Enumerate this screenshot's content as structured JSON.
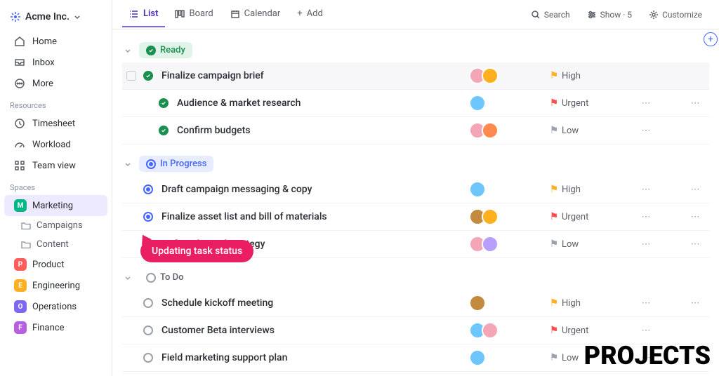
{
  "workspace": {
    "name": "Acme Inc."
  },
  "nav": {
    "home": "Home",
    "inbox": "Inbox",
    "more": "More"
  },
  "resources": {
    "label": "Resources",
    "timesheet": "Timesheet",
    "workload": "Workload",
    "teamview": "Team view"
  },
  "spaces": {
    "label": "Spaces",
    "items": [
      {
        "initial": "M",
        "color": "#00b884",
        "label": "Marketing",
        "active": true
      },
      {
        "initial": "P",
        "color": "#ff5c5c",
        "label": "Product"
      },
      {
        "initial": "E",
        "color": "#ffb020",
        "label": "Engineering"
      },
      {
        "initial": "O",
        "color": "#7b68ee",
        "label": "Operations"
      },
      {
        "initial": "F",
        "color": "#b660e0",
        "label": "Finance"
      }
    ],
    "sub": [
      {
        "label": "Campaigns"
      },
      {
        "label": "Content"
      }
    ]
  },
  "views": {
    "list": "List",
    "board": "Board",
    "calendar": "Calendar",
    "add": "Add"
  },
  "toolbar": {
    "search": "Search",
    "show": "Show · 5",
    "customize": "Customize"
  },
  "groups": [
    {
      "status": "ready",
      "label": "Ready",
      "tasks": [
        {
          "title": "Finalize campaign brief",
          "avatars": [
            "#f4a6b7",
            "#ffb020"
          ],
          "flag": "#ffb020",
          "priority": "High",
          "highlight": true,
          "checkbox": true,
          "showMore1": false
        },
        {
          "title": "Audience & market research",
          "avatars": [
            "#6ec6ff"
          ],
          "flag": "#ff4d4d",
          "priority": "Urgent",
          "sub": true,
          "showMore2": true
        },
        {
          "title": "Confirm budgets",
          "avatars": [
            "#f4a6b7",
            "#ff8a50"
          ],
          "flag": "#9aa0aa",
          "priority": "Low",
          "sub": true
        }
      ]
    },
    {
      "status": "prog",
      "label": "In Progress",
      "tasks": [
        {
          "title": "Draft campaign messaging & copy",
          "avatars": [
            "#6ec6ff"
          ],
          "flag": "#ffb020",
          "priority": "High",
          "showMore2": true
        },
        {
          "title": "Finalize asset list and bill of materials",
          "avatars": [
            "#c48a3f",
            "#ffb020"
          ],
          "flag": "#ff4d4d",
          "priority": "Urgent",
          "showMore2": true
        },
        {
          "title": "Define channel strategy",
          "avatars": [
            "#f4a6b7",
            "#b89eff"
          ],
          "flag": "#9aa0aa",
          "priority": "Low",
          "showMore2": true
        }
      ]
    },
    {
      "status": "todo",
      "label": "To Do",
      "tasks": [
        {
          "title": "Schedule kickoff meeting",
          "avatars": [
            "#c48a3f"
          ],
          "flag": "#ffb020",
          "priority": "High",
          "showMore2": true
        },
        {
          "title": "Customer Beta interviews",
          "avatars": [
            "#6ec6ff",
            "#f4a6b7"
          ],
          "flag": "#ff4d4d",
          "priority": "Urgent"
        },
        {
          "title": "Field marketing support plan",
          "avatars": [
            "#6ec6ff"
          ],
          "flag": "#9aa0aa",
          "priority": "Low"
        }
      ]
    }
  ],
  "callout": "Updating task status",
  "watermark": "PROJECTS"
}
